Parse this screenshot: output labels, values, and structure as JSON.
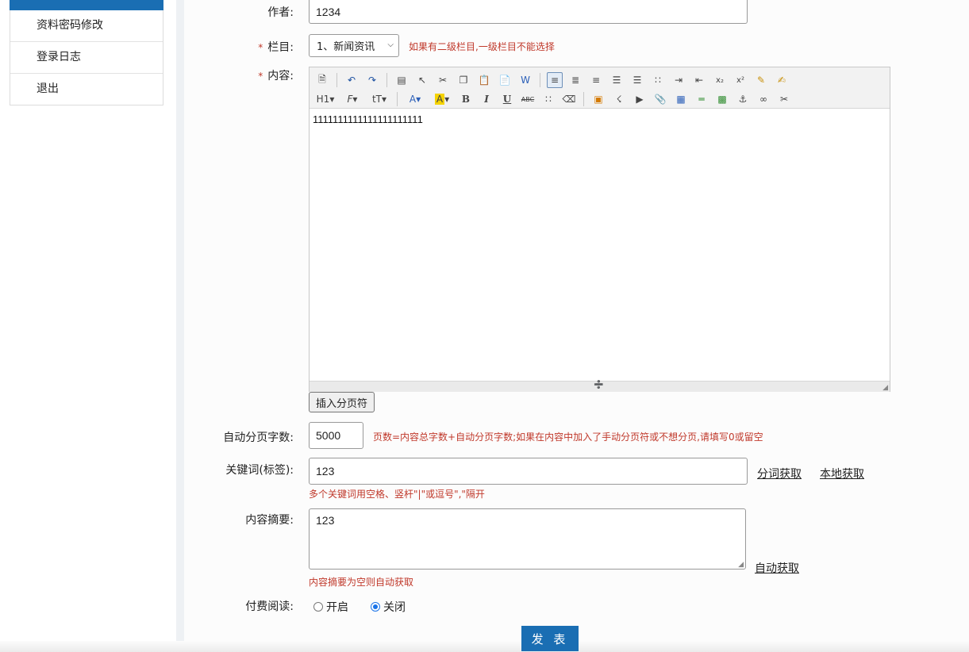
{
  "sidebar": {
    "items": [
      {
        "label": "资料密码修改"
      },
      {
        "label": "登录日志"
      },
      {
        "label": "退出"
      }
    ]
  },
  "form": {
    "author": {
      "label": "作者:",
      "value": "1234"
    },
    "column": {
      "required": "*",
      "label": "栏目:",
      "selected": "1、新闻资讯",
      "hint": "如果有二级栏目,一级栏目不能选择"
    },
    "content": {
      "required": "*",
      "label": "内容:",
      "text": "1111111111111111111111"
    },
    "insert_page_break_label": "插入分页符",
    "auto_page": {
      "label": "自动分页字数:",
      "value": "5000",
      "hint": "页数=内容总字数+自动分页字数;如果在内容中加入了手动分页符或不想分页,请填写0或留空"
    },
    "keywords": {
      "label": "关键词(标签):",
      "value": "123",
      "hint": "多个关键词用空格、竖杆\"|\"或逗号\",\"隔开",
      "split_link": "分词获取",
      "local_link": "本地获取"
    },
    "summary": {
      "label": "内容摘要:",
      "value": "123",
      "hint": "内容摘要为空则自动获取",
      "auto_link": "自动获取"
    },
    "paid": {
      "label": "付费阅读:",
      "on_label": "开启",
      "off_label": "关闭",
      "selected": "关闭"
    },
    "submit_label": "发 表"
  },
  "toolbar_icons": {
    "row1": [
      "source-icon",
      "undo-icon",
      "redo-icon",
      "template-icon",
      "select-icon",
      "cut-icon",
      "copy-icon",
      "paste-icon",
      "paste-text-icon",
      "paste-word-icon",
      "align-left-icon",
      "align-center-icon",
      "align-right-icon",
      "justify-icon",
      "ordered-list-icon",
      "unordered-list-icon",
      "indent-icon",
      "outdent-icon",
      "subscript-icon",
      "superscript-icon",
      "clear-format-icon",
      "quick-format-icon"
    ],
    "row2": [
      "heading-icon",
      "font-family-icon",
      "font-size-icon",
      "font-color-icon",
      "highlight-icon",
      "bold-icon",
      "italic-icon",
      "underline-icon",
      "strikethrough-icon",
      "line-height-icon",
      "eraser-icon",
      "image-icon",
      "flash-icon",
      "media-icon",
      "attachment-icon",
      "table-icon",
      "hr-icon",
      "emoticon-icon",
      "anchor-icon",
      "link-icon",
      "unlink-icon"
    ]
  },
  "colors": {
    "accent": "#1a6eb3",
    "hint": "#c0392b"
  }
}
